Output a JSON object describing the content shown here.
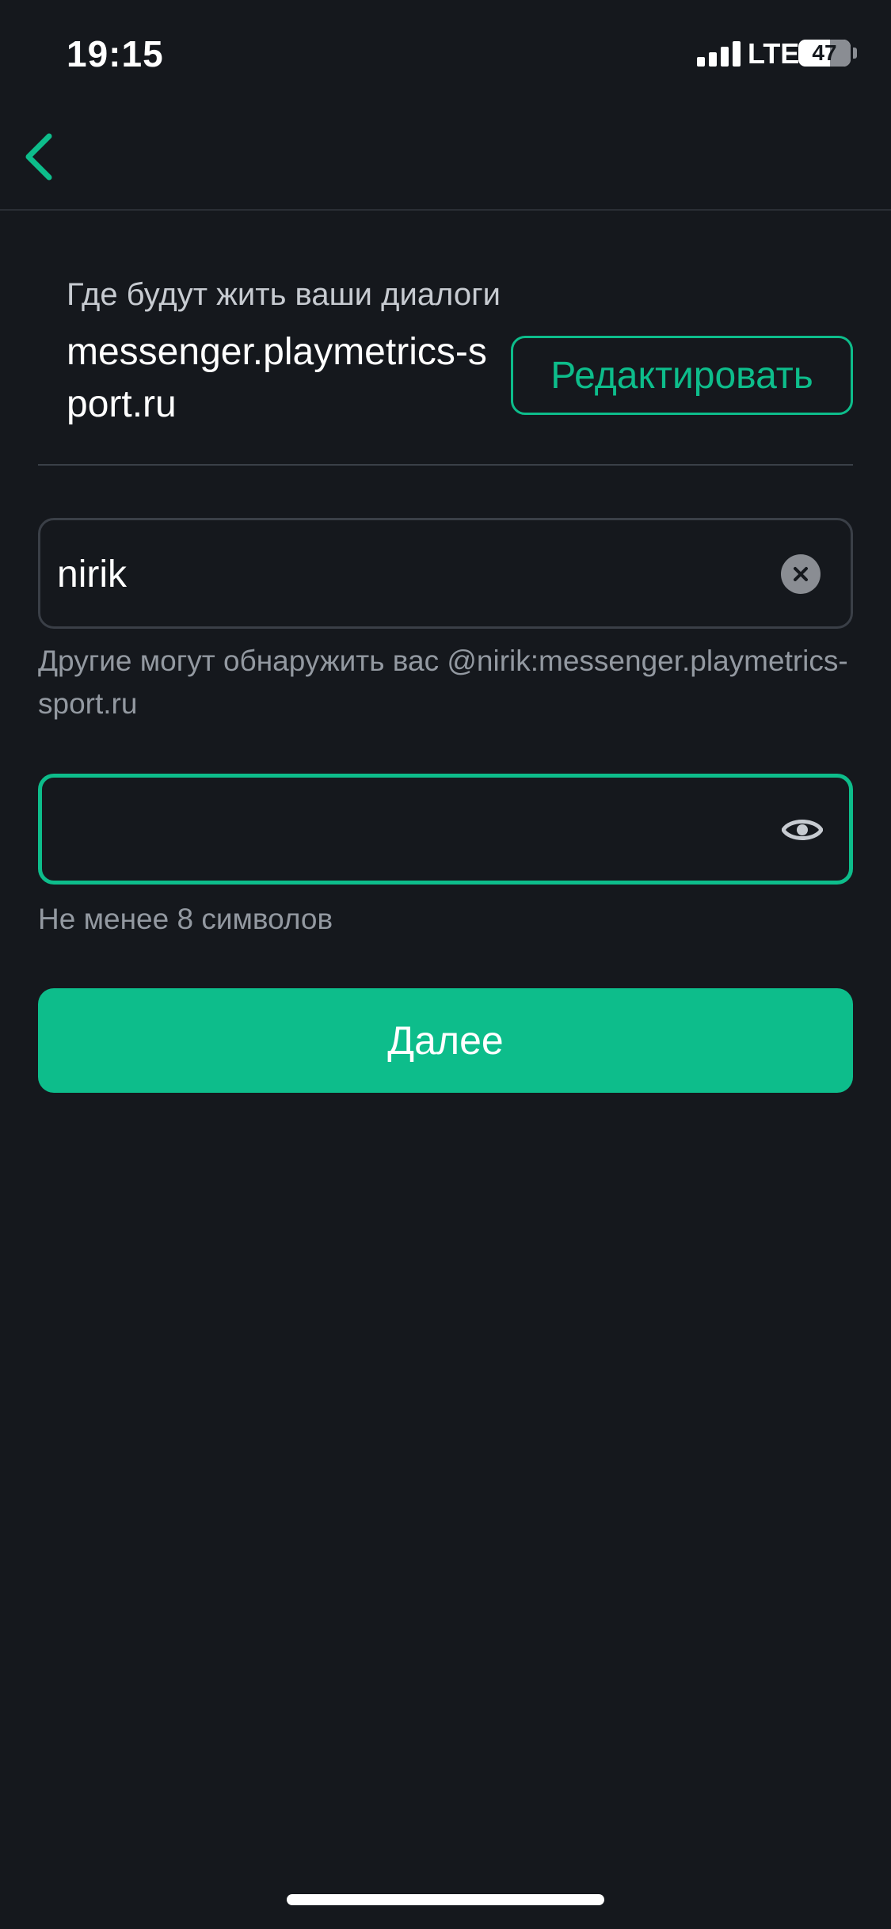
{
  "status_bar": {
    "time": "19:15",
    "network": "LTE",
    "battery": "47"
  },
  "server": {
    "caption": "Где будут жить ваши диалоги",
    "name": "messenger.playmetrics-sport.ru",
    "edit_label": "Редактировать"
  },
  "username": {
    "value": "nirik",
    "hint": "Другие могут обнаружить вас @nirik:messenger.playmetrics-sport.ru"
  },
  "password": {
    "value": "",
    "hint": "Не менее 8 символов"
  },
  "next_label": "Далее",
  "colors": {
    "accent": "#0dbd8b",
    "background": "#15181d",
    "secondary_text": "#9399a1"
  },
  "icons": {
    "back": "chevron-left-icon",
    "clear": "clear-circle-icon",
    "password_visibility": "eye-icon",
    "signal": "signal-bars-icon",
    "battery": "battery-icon"
  }
}
